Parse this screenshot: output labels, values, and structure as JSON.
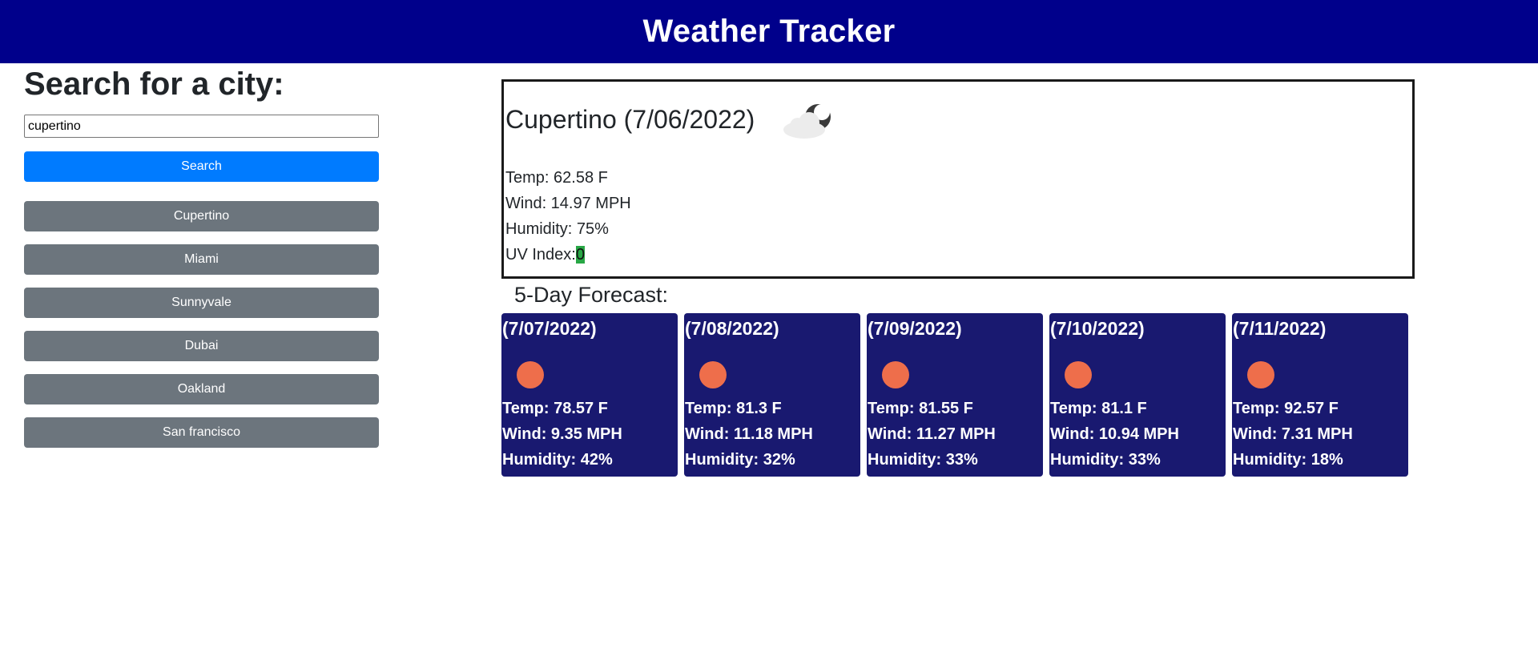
{
  "header": {
    "title": "Weather Tracker"
  },
  "search": {
    "heading": "Search for a city:",
    "input_value": "cupertino",
    "button_label": "Search"
  },
  "history": [
    {
      "label": "Cupertino"
    },
    {
      "label": "Miami"
    },
    {
      "label": "Sunnyvale"
    },
    {
      "label": "Dubai"
    },
    {
      "label": "Oakland"
    },
    {
      "label": "San francisco"
    }
  ],
  "current": {
    "title": "Cupertino (7/06/2022)",
    "icon": "partly-cloudy-night-icon",
    "temp": "Temp: 62.58 F",
    "wind": "Wind: 14.97 MPH",
    "humidity": "Humidity: 75%",
    "uv_label": "UV Index:",
    "uv_value": "0"
  },
  "forecast": {
    "heading": "5-Day Forecast:",
    "days": [
      {
        "date": "(7/07/2022)",
        "icon": "sun-icon",
        "temp": "Temp: 78.57 F",
        "wind": "Wind: 9.35 MPH",
        "humidity": "Humidity: 42%"
      },
      {
        "date": "(7/08/2022)",
        "icon": "sun-icon",
        "temp": "Temp: 81.3 F",
        "wind": "Wind: 11.18 MPH",
        "humidity": "Humidity: 32%"
      },
      {
        "date": "(7/09/2022)",
        "icon": "sun-icon",
        "temp": "Temp: 81.55 F",
        "wind": "Wind: 11.27 MPH",
        "humidity": "Humidity: 33%"
      },
      {
        "date": "(7/10/2022)",
        "icon": "sun-icon",
        "temp": "Temp: 81.1 F",
        "wind": "Wind: 10.94 MPH",
        "humidity": "Humidity: 33%"
      },
      {
        "date": "(7/11/2022)",
        "icon": "sun-icon",
        "temp": "Temp: 92.57 F",
        "wind": "Wind: 7.31 MPH",
        "humidity": "Humidity: 18%"
      }
    ]
  },
  "colors": {
    "header_bg": "#00008b",
    "search_button": "#007bff",
    "history_button": "#6c757d",
    "forecast_card": "#191970",
    "uv_badge": "#28a745",
    "sun": "#ee6e4b"
  }
}
